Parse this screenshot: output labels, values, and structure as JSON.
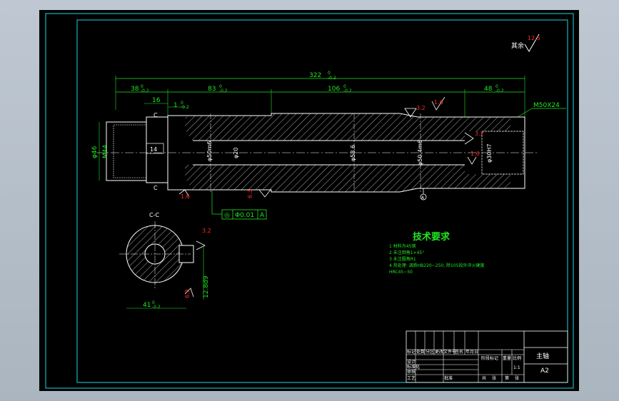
{
  "drawing": {
    "surface_finish_other": "其余",
    "surface_finish_other_value": "12.5",
    "dims": {
      "total_length": "322",
      "left_len": "38",
      "mid1_len": "83",
      "mid2_len": "106",
      "right_len": "48",
      "small_16": "16",
      "small_1": "1",
      "thread_right": "M50X24",
      "dia_46": "φ46",
      "thread_left": "M44",
      "dia_50": "φ50m6",
      "dia_20": "φ20",
      "dia_58": "φ58.6",
      "dia_50_right": "φ50.4m6",
      "bore_30": "φ30H7",
      "boxed_14": "14"
    },
    "tol_upper": "0",
    "tol_lower": "-0.2",
    "roughness": {
      "r16a": "1.6",
      "r16b": "1.6",
      "r16c": "1.6",
      "r63a": "6.3",
      "r32": "3.2",
      "r32b": "3.2",
      "r63b": "6.3",
      "r125": "12.5"
    },
    "gdt": {
      "symbol": "◎",
      "value": "Φ0.01",
      "datum": "A"
    },
    "datum_label": "A",
    "section": {
      "title": "C-C",
      "width_label": "12.8d9",
      "bottom_dim": "41",
      "cut_label": "C"
    }
  },
  "tech_requirements": {
    "title": "技术要求",
    "lines": [
      "1 材料为45钢",
      "2 未注倒角1×45°",
      "3 未注圆角R1",
      "4 热处理: 调质HB220~250, 除105段外淬火硬度",
      "HRC45~50"
    ]
  },
  "title_block": {
    "part_name": "主轴",
    "sheet_size": "A2",
    "cells": [
      "标记",
      "处数",
      "分区",
      "更改文件号",
      "签名",
      "年月日",
      "设计",
      "标准化",
      "审核",
      "工艺",
      "批准",
      "阶段标记",
      "重量",
      "比例",
      "共",
      "张",
      "第",
      "张",
      "1:1"
    ]
  }
}
